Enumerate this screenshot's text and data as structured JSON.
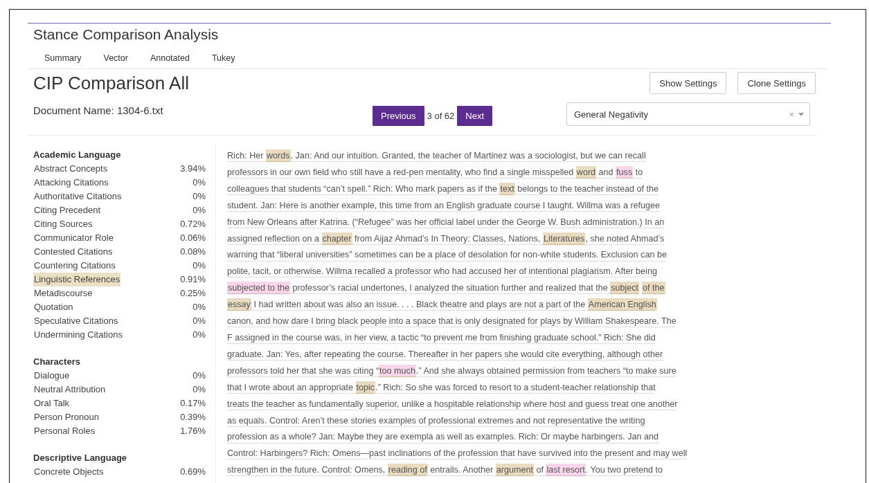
{
  "app_title": "Stance Comparison Analysis",
  "tabs": [
    {
      "label": "Summary",
      "selected": false
    },
    {
      "label": "Vector",
      "selected": false
    },
    {
      "label": "Annotated",
      "selected": false
    },
    {
      "label": "Tukey",
      "selected": false
    }
  ],
  "page_title": "CIP Comparison All",
  "buttons": [
    "Show Settings",
    "Clone Settings"
  ],
  "document_name": "Document Name: 1304-6.txt",
  "pager": {
    "previous": "Previous",
    "position": "3 of 62",
    "next": "Next"
  },
  "category_select": {
    "value": "General Negativity",
    "clear": "×"
  },
  "sidebar": [
    {
      "title": "Academic Language",
      "items": [
        {
          "label": "Abstract Concepts",
          "value": "3.94%",
          "selected": false
        },
        {
          "label": "Attacking Citations",
          "value": "0%",
          "selected": false
        },
        {
          "label": "Authoritative Citations",
          "value": "0%",
          "selected": false
        },
        {
          "label": "Citing Precedent",
          "value": "0%",
          "selected": false
        },
        {
          "label": "Citing Sources",
          "value": "0.72%",
          "selected": false
        },
        {
          "label": "Communicator Role",
          "value": "0.06%",
          "selected": false
        },
        {
          "label": "Contested Citations",
          "value": "0.08%",
          "selected": false
        },
        {
          "label": "Countering Citations",
          "value": "0%",
          "selected": false
        },
        {
          "label": "Linguistic References",
          "value": "0.91%",
          "selected": true
        },
        {
          "label": "Metadiscourse",
          "value": "0.25%",
          "selected": false
        },
        {
          "label": "Quotation",
          "value": "0%",
          "selected": false
        },
        {
          "label": "Speculative Citations",
          "value": "0%",
          "selected": false
        },
        {
          "label": "Undermining Citations",
          "value": "0%",
          "selected": false
        }
      ]
    },
    {
      "title": "Characters",
      "items": [
        {
          "label": "Dialogue",
          "value": "0%",
          "selected": false
        },
        {
          "label": "Neutral Attribution",
          "value": "0%",
          "selected": false
        },
        {
          "label": "Oral Talk",
          "value": "0.17%",
          "selected": false
        },
        {
          "label": "Person Pronoun",
          "value": "0.39%",
          "selected": false
        },
        {
          "label": "Personal Roles",
          "value": "1.76%",
          "selected": false
        }
      ]
    },
    {
      "title": "Descriptive Language",
      "items": [
        {
          "label": "Concrete Objects",
          "value": "0.69%",
          "selected": false
        }
      ]
    }
  ],
  "passage": [
    [
      {
        "text": "Rich: Her "
      },
      {
        "text": "words",
        "color": "#e8dbbf"
      },
      {
        "text": ". Jan: And our intuition. Granted, the teacher of Martinez was a sociologist, but we can recall"
      }
    ],
    [
      {
        "text": "professors in our own field who still have a red-pen mentality, who find a single misspelled "
      },
      {
        "text": "word",
        "color": "#e8dbbf"
      },
      {
        "text": " and "
      },
      {
        "text": "fuss",
        "color": "#fbd6ea"
      },
      {
        "text": " to"
      }
    ],
    [
      {
        "text": "colleagues that students “can’t spell.” Rich: Who mark papers as if the "
      },
      {
        "text": "text",
        "color": "#e8dbbf"
      },
      {
        "text": " belongs to the teacher instead of the"
      }
    ],
    [
      {
        "text": "student.  Jan: Here is another example, this time from an English graduate course I taught. Willma was a refugee"
      }
    ],
    [
      {
        "text": "from New Orleans after Katrina. (“Refugee” was her official label under the George W. Bush administration.) In an"
      }
    ],
    [
      {
        "text": "assigned reflection on a "
      },
      {
        "text": "chapter",
        "color": "#e8dbbf"
      },
      {
        "text": " from Aijaz Ahmad’s In Theory: Classes, Nations, "
      },
      {
        "text": "Literatures",
        "color": "#e8dbbf"
      },
      {
        "text": ", she noted Ahmad’s"
      }
    ],
    [
      {
        "text": "warning that “liberal universities” sometimes can be a place of desolation for non-white students. Exclusion can be"
      }
    ],
    [
      {
        "text": "polite, tacit, or otherwise. Willma recalled a professor who had accused her of intentional plagiarism. After being"
      }
    ],
    [
      {
        "text": "subjected to the",
        "color": "#fbd6ea"
      },
      {
        "text": " professor’s racial undertones, I analyzed the situation further and realized that the "
      },
      {
        "text": "subject",
        "color": "#e8dbbf"
      },
      {
        "text": "of the",
        "color": "#e8dbbf"
      }
    ],
    [
      {
        "text": "essay",
        "color": "#e8dbbf"
      },
      {
        "text": " I had written about was also an issue. . . . Black theatre and plays are not a part of the "
      },
      {
        "text": "American English",
        "color": "#e8dbbf"
      }
    ],
    [
      {
        "text": "canon, and how dare I bring black people into a space that is only designated for plays by William Shakespeare.  The"
      }
    ],
    [
      {
        "text": "F assigned in the course was, in her view, a tactic “to prevent me from finishing graduate school.” Rich: She did"
      }
    ],
    [
      {
        "text": "graduate. Jan: Yes, after repeating the course. Thereafter in her papers she would cite everything, although other"
      }
    ],
    [
      {
        "text": "professors told her that she was citing “"
      },
      {
        "text": "too much",
        "color": "#fbd6ea"
      },
      {
        "text": ".” And she always obtained permission from teachers “to make sure"
      }
    ],
    [
      {
        "text": "that I wrote about an appropriate "
      },
      {
        "text": "topic",
        "color": "#e8dbbf"
      },
      {
        "text": ".”  Rich: So she was forced to resort to a student-teacher relationship that"
      }
    ],
    [
      {
        "text": "treats the teacher as fundamentally superior, unlike a hospitable relationship where host and guess treat one another"
      }
    ],
    [
      {
        "text": "as equals. Control: Aren’t these stories examples of professional extremes and not representative the writing"
      }
    ],
    [
      {
        "text": "profession as a whole? Jan: Maybe they are exempla as well as examples. Rich: Or maybe harbingers. Jan and"
      }
    ],
    [
      {
        "text": "Control: Harbingers? Rich: Omens—past inclinations of the profession that have survived into the present and may well"
      }
    ],
    [
      {
        "text": "strengthen in the future. Control: Omens, "
      },
      {
        "text": "reading of",
        "color": "#e8dbbf"
      },
      {
        "text": " entrails. Another "
      },
      {
        "text": "argument",
        "color": "#e8dbbf"
      },
      {
        "text": " of "
      },
      {
        "text": "last resort",
        "color": "#fbd6ea"
      },
      {
        "text": ". You two pretend to"
      }
    ]
  ]
}
